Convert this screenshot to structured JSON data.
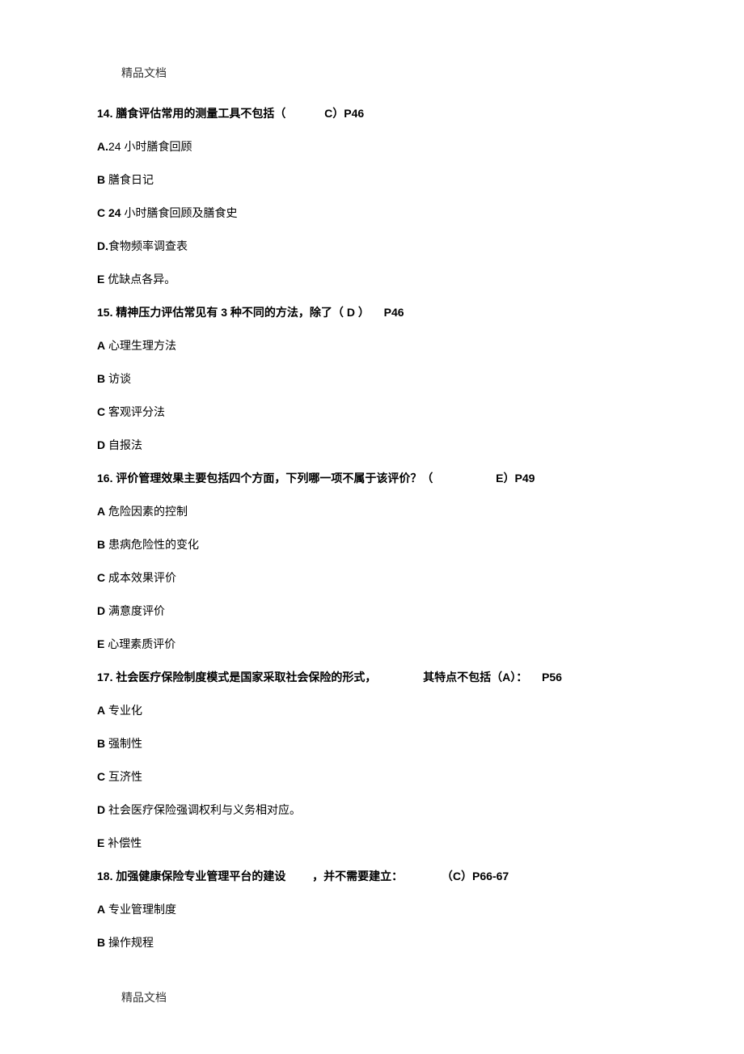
{
  "header": "精品文档",
  "footer": "精品文档",
  "questions": [
    {
      "num": "14.",
      "text_parts": [
        "膳食评估常用的测量工具不包括（",
        "C）P46"
      ],
      "options": [
        {
          "label": "A.",
          "text": "24 小时膳食回顾"
        },
        {
          "label": "B",
          "text": " 膳食日记"
        },
        {
          "label": "C 24",
          "text": " 小时膳食回顾及膳食史"
        },
        {
          "label": "D.",
          "text": "食物频率调查表"
        },
        {
          "label": "E",
          "text": " 优缺点各异。"
        }
      ]
    },
    {
      "num": "15.",
      "text_parts": [
        "精神压力评估常见有 3 种不同的方法，除了（ D ）",
        "P46"
      ],
      "options": [
        {
          "label": "A",
          "text": " 心理生理方法"
        },
        {
          "label": "B",
          "text": " 访谈"
        },
        {
          "label": "C",
          "text": " 客观评分法"
        },
        {
          "label": "D",
          "text": " 自报法"
        }
      ]
    },
    {
      "num": "16.",
      "text_parts": [
        "评价管理效果主要包括四个方面，下列哪一项不属于该评价？（",
        "E）P49"
      ],
      "options": [
        {
          "label": "A",
          "text": " 危险因素的控制"
        },
        {
          "label": "B",
          "text": " 患病危险性的变化"
        },
        {
          "label": "C",
          "text": " 成本效果评价"
        },
        {
          "label": "D",
          "text": " 满意度评价"
        },
        {
          "label": "E",
          "text": " 心理素质评价"
        }
      ]
    },
    {
      "num": "17.",
      "text_parts": [
        "社会医疗保险制度模式是国家采取社会保险的形式，",
        "其特点不包括（A）：",
        "P56"
      ],
      "options": [
        {
          "label": "A",
          "text": " 专业化"
        },
        {
          "label": "B",
          "text": " 强制性"
        },
        {
          "label": "C",
          "text": " 互济性"
        },
        {
          "label": "D",
          "text": " 社会医疗保险强调权利与义务相对应。"
        },
        {
          "label": "E",
          "text": " 补偿性"
        }
      ]
    },
    {
      "num": "18.",
      "text_parts": [
        "加强健康保险专业管理平台的建设",
        "，并不需要建立：",
        "（C）P66-67"
      ],
      "options": [
        {
          "label": "A",
          "text": " 专业管理制度"
        },
        {
          "label": "B",
          "text": " 操作规程"
        }
      ]
    }
  ]
}
